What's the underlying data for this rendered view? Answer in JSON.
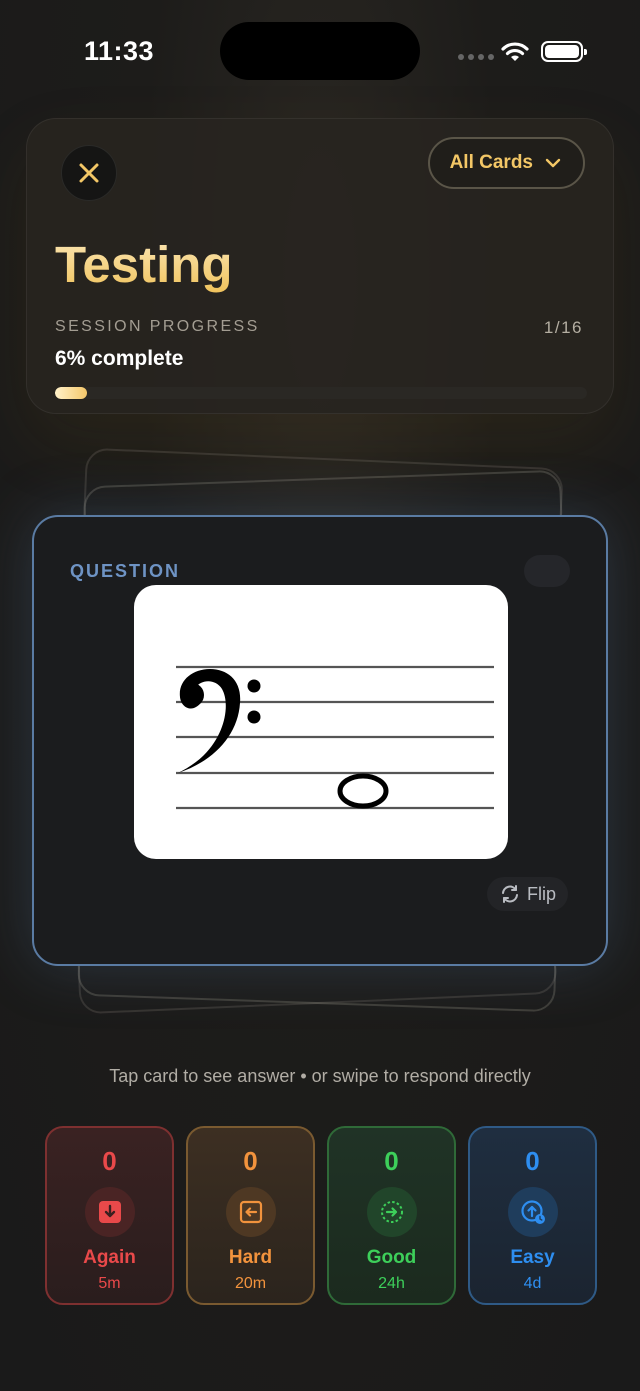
{
  "status_bar": {
    "time": "11:33"
  },
  "header": {
    "filter_label": "All Cards",
    "title": "Testing",
    "progress_label": "SESSION PROGRESS",
    "progress_count": "1/16",
    "progress_text": "6% complete",
    "progress_fraction": 0.06
  },
  "card": {
    "label": "QUESTION",
    "flip_label": "Flip",
    "image": "bass-clef-staff-note"
  },
  "hint": "Tap card to see answer • or swipe to respond directly",
  "answers": [
    {
      "count": "0",
      "name": "Again",
      "time": "5m",
      "icon": "arrow-down-icon",
      "color": "#e9494a"
    },
    {
      "count": "0",
      "name": "Hard",
      "time": "20m",
      "icon": "arrow-left-box-icon",
      "color": "#f2933d"
    },
    {
      "count": "0",
      "name": "Good",
      "time": "24h",
      "icon": "arrow-right-circle-icon",
      "color": "#3dcf5a"
    },
    {
      "count": "0",
      "name": "Easy",
      "time": "4d",
      "icon": "arrow-up-circle-icon",
      "color": "#2e8ef0"
    }
  ]
}
